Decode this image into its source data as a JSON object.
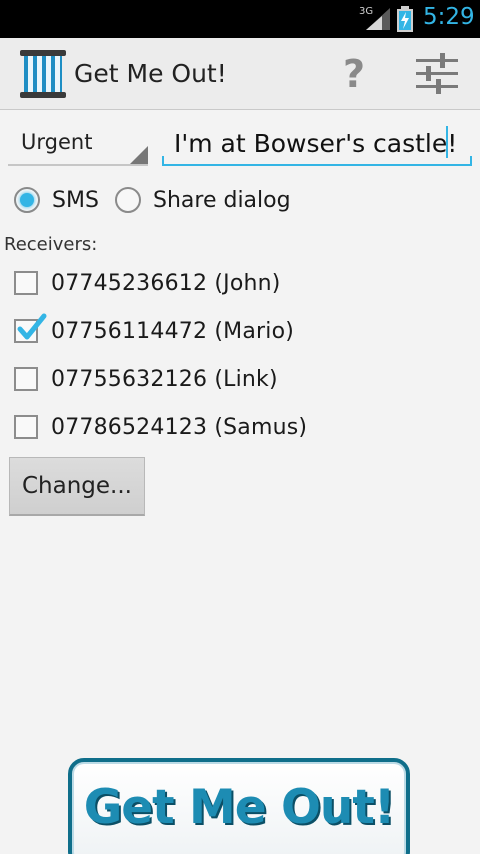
{
  "status_bar": {
    "network": "3G",
    "time": "5:29"
  },
  "action_bar": {
    "title": "Get Me Out!",
    "help_label": "?"
  },
  "message": {
    "priority": "Urgent",
    "text": "I'm at Bowser's castle!"
  },
  "send_method": {
    "options": [
      {
        "label": "SMS",
        "selected": true
      },
      {
        "label": "Share dialog",
        "selected": false
      }
    ]
  },
  "receivers": {
    "label": "Receivers:",
    "items": [
      {
        "label": "07745236612 (John)",
        "checked": false
      },
      {
        "label": "07756114472 (Mario)",
        "checked": true
      },
      {
        "label": "07755632126 (Link)",
        "checked": false
      },
      {
        "label": "07786524123 (Samus)",
        "checked": false
      }
    ],
    "change_label": "Change..."
  },
  "main_button": {
    "label": "Get Me Out!"
  },
  "colors": {
    "accent": "#33b5e5",
    "button_text": "#1d8cb3",
    "button_border": "#0f6e8a"
  }
}
